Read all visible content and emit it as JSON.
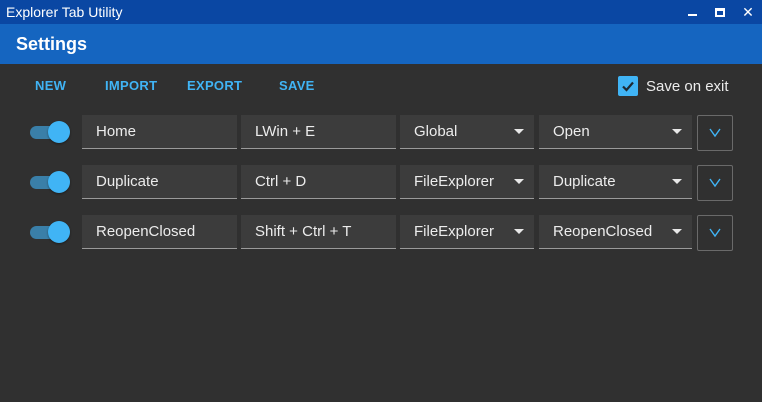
{
  "window": {
    "title": "Explorer Tab Utility",
    "controls": {
      "minimize_icon": "minimize-icon",
      "maximize_icon": "maximize-icon",
      "close_icon": "close-icon"
    }
  },
  "header": {
    "title": "Settings"
  },
  "toolbar": {
    "new_label": "NEW",
    "import_label": "IMPORT",
    "export_label": "EXPORT",
    "save_label": "SAVE",
    "save_on_exit": {
      "label": "Save on exit",
      "checked": true
    }
  },
  "rows": [
    {
      "enabled": true,
      "name": "Home",
      "hotkey": "LWin + E",
      "scope": "Global",
      "action": "Open"
    },
    {
      "enabled": true,
      "name": "Duplicate",
      "hotkey": "Ctrl + D",
      "scope": "FileExplorer",
      "action": "Duplicate"
    },
    {
      "enabled": true,
      "name": "ReopenClosed",
      "hotkey": "Shift + Ctrl + T",
      "scope": "FileExplorer",
      "action": "ReopenClosed"
    }
  ],
  "colors": {
    "titlebar": "#0a47a3",
    "header": "#1565c0",
    "accent": "#40b4f5",
    "background": "#303030",
    "field": "#3c3c3c"
  }
}
